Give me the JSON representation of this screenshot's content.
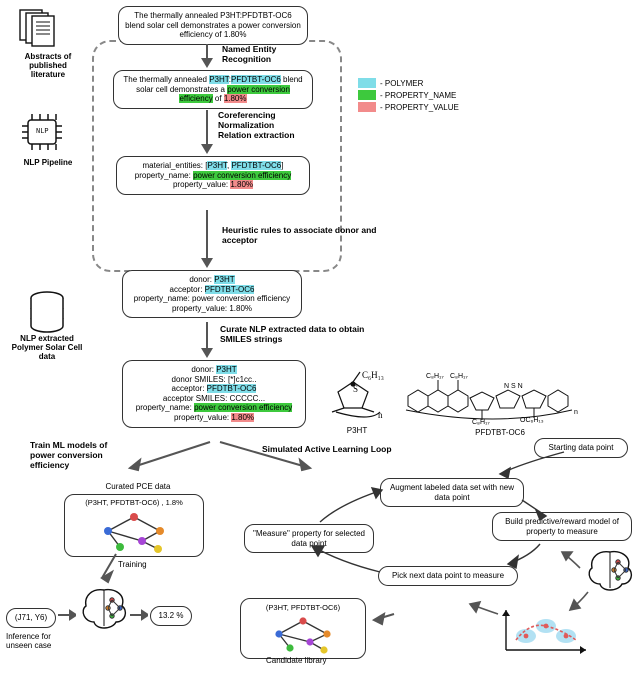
{
  "legend": {
    "polymer": "- POLYMER",
    "property_name": "- PROPERTY_NAME",
    "property_value": "- PROPERTY_VALUE"
  },
  "icons": {
    "abstracts": "Abstracts of published literature",
    "nlp_pipeline": "NLP Pipeline",
    "nlp_data": "NLP extracted Polymer Solar Cell data",
    "nlp_chip_label": "NLP"
  },
  "boxA": {
    "text_prefix": "The thermally annealed ",
    "chem": "P3HT:PFDTBT-OC6",
    "mid": " blend solar cell demonstrates a power conversion efficiency of ",
    "val": "1.80%"
  },
  "stepNER": "Named Entity Recognition",
  "boxB": {
    "text_prefix": "The thermally annealed ",
    "p1": "P3HT",
    "sep": ":",
    "p2": "PFDTBT-OC6",
    "mid1": " blend solar cell demonstrates a ",
    "prop": "power conversion efficiency",
    "mid2": " of ",
    "val": "1.80%"
  },
  "stepCNR": "Coreferencing\nNormalization\nRelation extraction",
  "boxC": {
    "l1a": "material_entities: [",
    "p1": "P3HT",
    "comma": ", ",
    "p2": "PFDTBT-OC6",
    "l1b": "]",
    "l2a": "property_name: ",
    "prop": "power conversion efficiency",
    "l3a": "property_value: ",
    "val": "1.80%"
  },
  "stepHeur": "Heuristic rules to associate donor and acceptor",
  "boxD": {
    "l1a": "donor: ",
    "p1": "P3HT",
    "l2a": "acceptor: ",
    "p2": "PFDTBT-OC6",
    "l3": "property_name: power conversion efficiency",
    "l4": "property_value: 1.80%"
  },
  "stepCurate": "Curate NLP extracted data to obtain SMILES strings",
  "boxE": {
    "l1a": "donor: ",
    "p1": "P3HT",
    "l2": "donor SMILES: [*]c1cc..",
    "l3a": "acceptor: ",
    "p2": "PFDTBT-OC6",
    "l4": "acceptor SMILES: CCCCC...",
    "l5a": "property_name: ",
    "prop": "power conversion efficiency",
    "l6a": "property_value: ",
    "val": "1.80%"
  },
  "molecules": {
    "m1": "P3HT",
    "m2": "PFDTBT-OC6",
    "m1_formula": "C₆H₁₃",
    "m1_sub": "n"
  },
  "branchLeft": "Train ML models of power conversion efficiency",
  "branchRight": "Simulated Active Learning Loop",
  "curated_title": "Curated PCE data",
  "curated_tuple": "(P3HT, PFDTBT-OC6) , 1.8%",
  "training_lbl": "Training",
  "inf_in": "(J71, Y6)",
  "inf_out": "13.2 %",
  "inf_caption": "Inference for unseen case",
  "al": {
    "start": "Starting data point",
    "augment": "Augment labeled data set with new data point",
    "measure": "\"Measure\" property for selected data point",
    "build": "Build predictive/reward model of property to measure",
    "pick": "Pick next data point to measure",
    "cand_tuple": "(P3HT, PFDTBT-OC6)",
    "cand_lbl": "Candidate library"
  }
}
